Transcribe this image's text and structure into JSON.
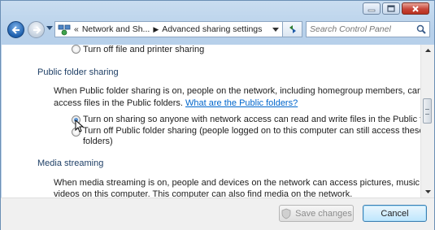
{
  "window": {
    "accent": "#1d5fad"
  },
  "nav": {
    "breadcrumb_prefix": "«",
    "crumbs": [
      "Network and Sh...",
      "Advanced sharing settings"
    ],
    "search_placeholder": "Search Control Panel"
  },
  "content": {
    "top_option": "Turn off file and printer sharing",
    "public_folder": {
      "heading": "Public folder sharing",
      "desc_line1": "When Public folder sharing is on, people on the network, including homegroup members, can",
      "desc_line2": "access files in the Public folders.",
      "link": "What are the Public folders?",
      "option_on": "Turn on sharing so anyone with network access can read and write files in the Public folders",
      "option_off_line1": "Turn off Public folder sharing (people logged on to this computer can still access these",
      "option_off_line2": "folders)",
      "selected": "on"
    },
    "media": {
      "heading": "Media streaming",
      "desc_line1": "When media streaming is on, people and devices on the network can access pictures, music, and",
      "desc_line2": "videos on this computer. This computer can also find media on the network."
    }
  },
  "buttons": {
    "save": "Save changes",
    "cancel": "Cancel"
  }
}
